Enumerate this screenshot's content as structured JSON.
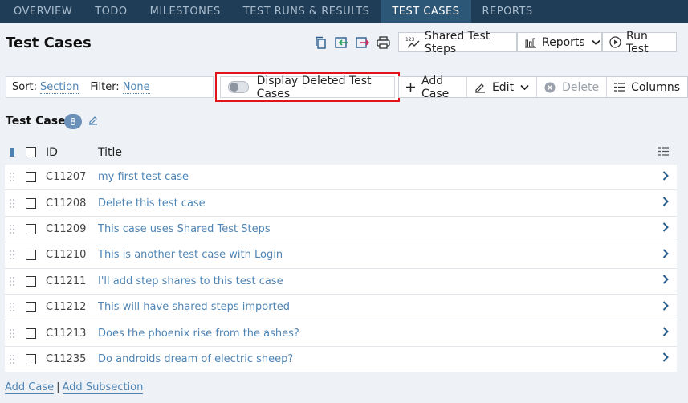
{
  "nav": {
    "tabs": [
      {
        "label": "OVERVIEW"
      },
      {
        "label": "TODO"
      },
      {
        "label": "MILESTONES"
      },
      {
        "label": "TEST RUNS & RESULTS"
      },
      {
        "label": "TEST CASES",
        "active": true
      },
      {
        "label": "REPORTS"
      }
    ]
  },
  "header": {
    "title": "Test Cases",
    "shared_steps_label": "Shared Test Steps",
    "shared_steps_icon_text": "123",
    "reports_label": "Reports",
    "run_test_label": "Run Test"
  },
  "toolbar": {
    "sort_label": "Sort:",
    "sort_value": "Section",
    "filter_label": "Filter:",
    "filter_value": "None",
    "toggle_label": "Display Deleted Test Cases",
    "toggle_on": false,
    "add_case_label": "Add Case",
    "edit_label": "Edit",
    "delete_label": "Delete",
    "columns_label": "Columns"
  },
  "section": {
    "title": "Test Cases",
    "count": "8"
  },
  "table": {
    "columns": {
      "id": "ID",
      "title": "Title"
    },
    "rows": [
      {
        "id": "C11207",
        "title": "my first test case"
      },
      {
        "id": "C11208",
        "title": "Delete this test case"
      },
      {
        "id": "C11209",
        "title": "This case uses Shared Test Steps"
      },
      {
        "id": "C11210",
        "title": "This is another test case with Login"
      },
      {
        "id": "C11211",
        "title": "I'll add step shares to this test case"
      },
      {
        "id": "C11212",
        "title": "This will have shared steps imported"
      },
      {
        "id": "C11213",
        "title": "Does the phoenix rise from the ashes?"
      },
      {
        "id": "C11235",
        "title": "Do androids dream of electric sheep?"
      }
    ]
  },
  "footer": {
    "add_case": "Add Case",
    "separator": "|",
    "add_subsection": "Add Subsection"
  },
  "colors": {
    "nav_bg": "#1f3d57",
    "nav_active": "#2c5777",
    "link": "#4f85b5",
    "highlight_border": "#e2141b",
    "badge": "#6a8fb8"
  }
}
